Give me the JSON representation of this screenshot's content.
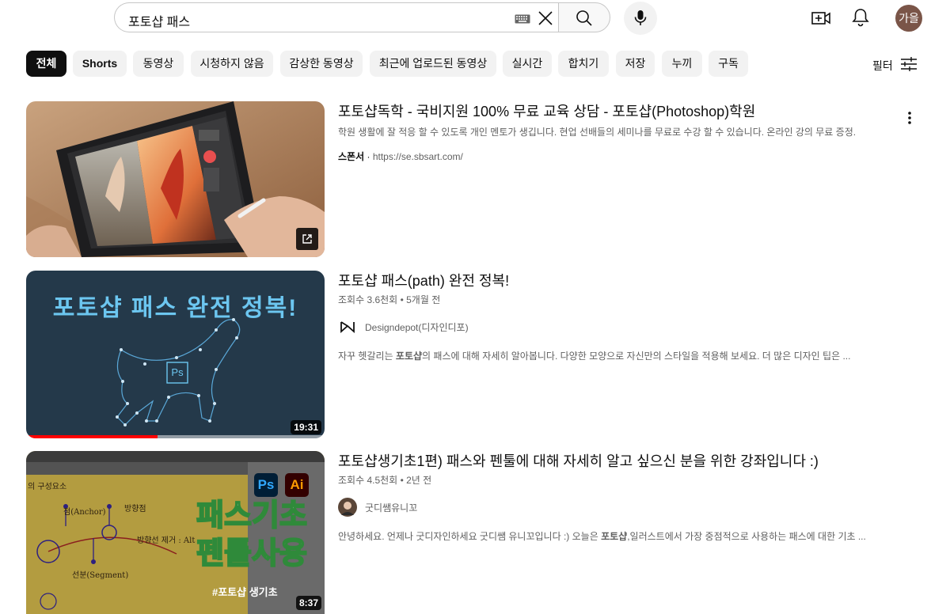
{
  "search": {
    "query": "포토샵 패스"
  },
  "header": {
    "avatar_text": "가을"
  },
  "chips": [
    {
      "label": "전체"
    },
    {
      "label": "Shorts"
    },
    {
      "label": "동영상"
    },
    {
      "label": "시청하지 않음"
    },
    {
      "label": "감상한 동영상"
    },
    {
      "label": "최근에 업로드된 동영상"
    },
    {
      "label": "실시간"
    },
    {
      "label": "합치기"
    },
    {
      "label": "저장"
    },
    {
      "label": "누끼"
    },
    {
      "label": "구독"
    }
  ],
  "filter": {
    "label": "필터"
  },
  "ad": {
    "title": "포토샵독학 - 국비지원 100% 무료 교육 상담 - 포토샵(Photoshop)학원",
    "description": "학원 생활에 잘 적응 할 수 있도록 개인 멘토가 생깁니다. 현업 선배들의 세미나를 무료로 수강 할 수 있습니다. 온라인 강의 무료 증정.",
    "sponsor_label": "스폰서",
    "url": "https://se.sbsart.com/"
  },
  "videos": [
    {
      "thumb_title": "포토샵 패스 완전 정복!",
      "thumb_badge": "Ps",
      "title": "포토샵 패스(path) 완전 정복!",
      "views": "조회수 3.6천회",
      "age": "5개월 전",
      "channel": "Designdepot(디자인디포)",
      "desc_before": "자꾸 헷갈리는 ",
      "desc_bold": "포토샵",
      "desc_after": "의 패스에 대해 자세히 알아봅니다. 다양한 모양으로 자신만의 스타일을 적용해 보세요. 더 많은 디자인 팁은 ...",
      "duration": "19:31",
      "watched_fraction": 0.44
    },
    {
      "thumb_line1": "패스기초",
      "thumb_line2": "펜툴사용",
      "thumb_tag": "#포토샵 생기초",
      "thumb_ps": "Ps",
      "thumb_ai": "Ai",
      "thumb_label_anchor": "점(Anchor)",
      "thumb_label_direction": "방향점",
      "thumb_label_segment": "선분(Segment)",
      "thumb_label_remove": "방향선 제거 : Alt",
      "thumb_label_element": "의 구성요소",
      "title": "포토샵생기초1편) 패스와 펜툴에 대해 자세히 알고 싶으신 분을 위한 강좌입니다 :)",
      "views": "조회수 4.5천회",
      "age": "2년 전",
      "channel": "굿디쌤유니꼬",
      "desc_before": "안녕하세요. 언제나 굿디자인하세요 굿디쌤 유니꼬입니다 :) 오늘은 ",
      "desc_bold": "포토샵",
      "desc_after": ",일러스트에서 가장 중점적으로 사용하는 패스에 대한 기초 ...",
      "duration": "8:37"
    }
  ]
}
